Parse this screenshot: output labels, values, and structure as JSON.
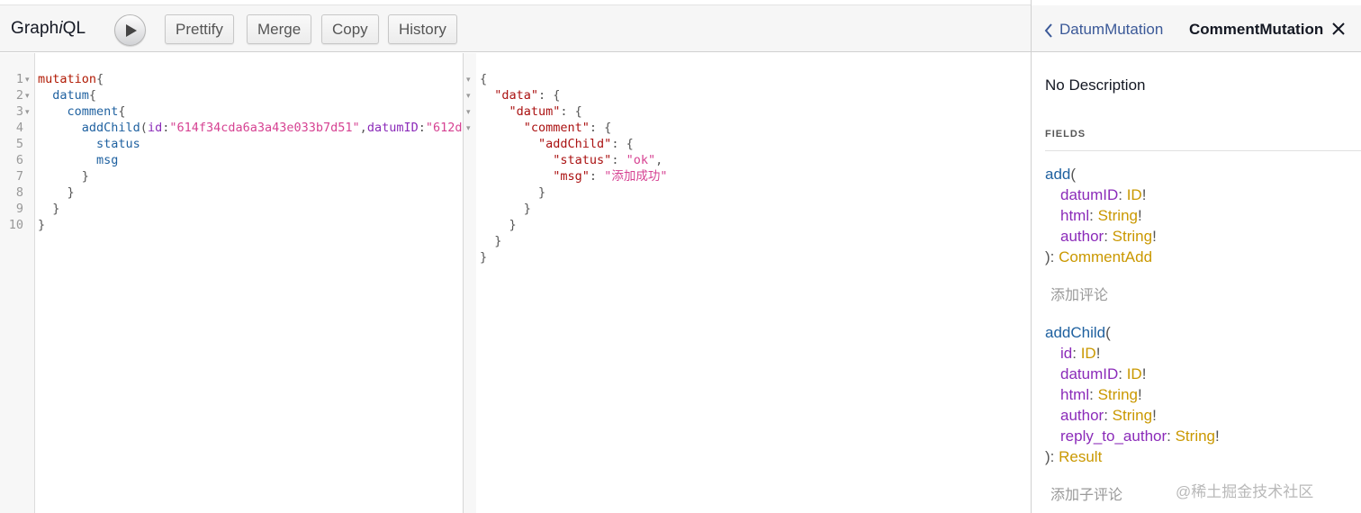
{
  "toolbar": {
    "title_prefix": "Graph",
    "title_italic": "i",
    "title_suffix": "QL",
    "buttons": [
      "Prettify",
      "Merge",
      "Copy",
      "History"
    ]
  },
  "query_editor": {
    "line_numbers": [
      "1",
      "2",
      "3",
      "4",
      "5",
      "6",
      "7",
      "8",
      "9",
      "10"
    ],
    "lines": [
      [
        {
          "t": "mutation",
          "c": "kw"
        },
        {
          "t": "{",
          "c": "pn"
        }
      ],
      [
        {
          "t": "  datum",
          "c": "fld"
        },
        {
          "t": "{",
          "c": "pn"
        }
      ],
      [
        {
          "t": "    comment",
          "c": "fld"
        },
        {
          "t": "{",
          "c": "pn"
        }
      ],
      [
        {
          "t": "      addChild",
          "c": "fld"
        },
        {
          "t": "(",
          "c": "pn"
        },
        {
          "t": "id",
          "c": "arg"
        },
        {
          "t": ":",
          "c": "pn"
        },
        {
          "t": "\"614f34cda6a3a43e033b7d51\"",
          "c": "str"
        },
        {
          "t": ",",
          "c": "pn"
        },
        {
          "t": "datumID",
          "c": "arg"
        },
        {
          "t": ":",
          "c": "pn"
        },
        {
          "t": "\"612d",
          "c": "str"
        }
      ],
      [
        {
          "t": "        status",
          "c": "fld"
        }
      ],
      [
        {
          "t": "        msg",
          "c": "fld"
        }
      ],
      [
        {
          "t": "      }",
          "c": "pn"
        }
      ],
      [
        {
          "t": "    }",
          "c": "pn"
        }
      ],
      [
        {
          "t": "  }",
          "c": "pn"
        }
      ],
      [
        {
          "t": "}",
          "c": "pn"
        }
      ]
    ]
  },
  "result": {
    "lines": [
      [
        {
          "t": "{",
          "c": "pn"
        }
      ],
      [
        {
          "t": "  \"data\"",
          "c": "jkey"
        },
        {
          "t": ": {",
          "c": "pn"
        }
      ],
      [
        {
          "t": "    \"datum\"",
          "c": "jkey"
        },
        {
          "t": ": {",
          "c": "pn"
        }
      ],
      [
        {
          "t": "      \"comment\"",
          "c": "jkey"
        },
        {
          "t": ": {",
          "c": "pn"
        }
      ],
      [
        {
          "t": "        \"addChild\"",
          "c": "jkey"
        },
        {
          "t": ": {",
          "c": "pn"
        }
      ],
      [
        {
          "t": "          \"status\"",
          "c": "jkey"
        },
        {
          "t": ": ",
          "c": "pn"
        },
        {
          "t": "\"ok\"",
          "c": "str"
        },
        {
          "t": ",",
          "c": "pn"
        }
      ],
      [
        {
          "t": "          \"msg\"",
          "c": "jkey"
        },
        {
          "t": ": ",
          "c": "pn"
        },
        {
          "t": "\"添加成功\"",
          "c": "str"
        }
      ],
      [
        {
          "t": "        }",
          "c": "pn"
        }
      ],
      [
        {
          "t": "      }",
          "c": "pn"
        }
      ],
      [
        {
          "t": "    }",
          "c": "pn"
        }
      ],
      [
        {
          "t": "  }",
          "c": "pn"
        }
      ],
      [
        {
          "t": "}",
          "c": "pn"
        }
      ]
    ]
  },
  "docs": {
    "back_label": "DatumMutation",
    "title": "CommentMutation",
    "description": "No Description",
    "section": "FIELDS",
    "fields": [
      {
        "name": "add",
        "args": [
          {
            "name": "datumID",
            "type": "ID"
          },
          {
            "name": "html",
            "type": "String"
          },
          {
            "name": "author",
            "type": "String"
          }
        ],
        "return_type": "CommentAdd",
        "description": "添加评论"
      },
      {
        "name": "addChild",
        "args": [
          {
            "name": "id",
            "type": "ID"
          },
          {
            "name": "datumID",
            "type": "ID"
          },
          {
            "name": "html",
            "type": "String"
          },
          {
            "name": "author",
            "type": "String"
          },
          {
            "name": "reply_to_author",
            "type": "String"
          }
        ],
        "return_type": "Result",
        "description": "添加子评论"
      }
    ]
  },
  "watermark": "@稀土掘金技术社区"
}
